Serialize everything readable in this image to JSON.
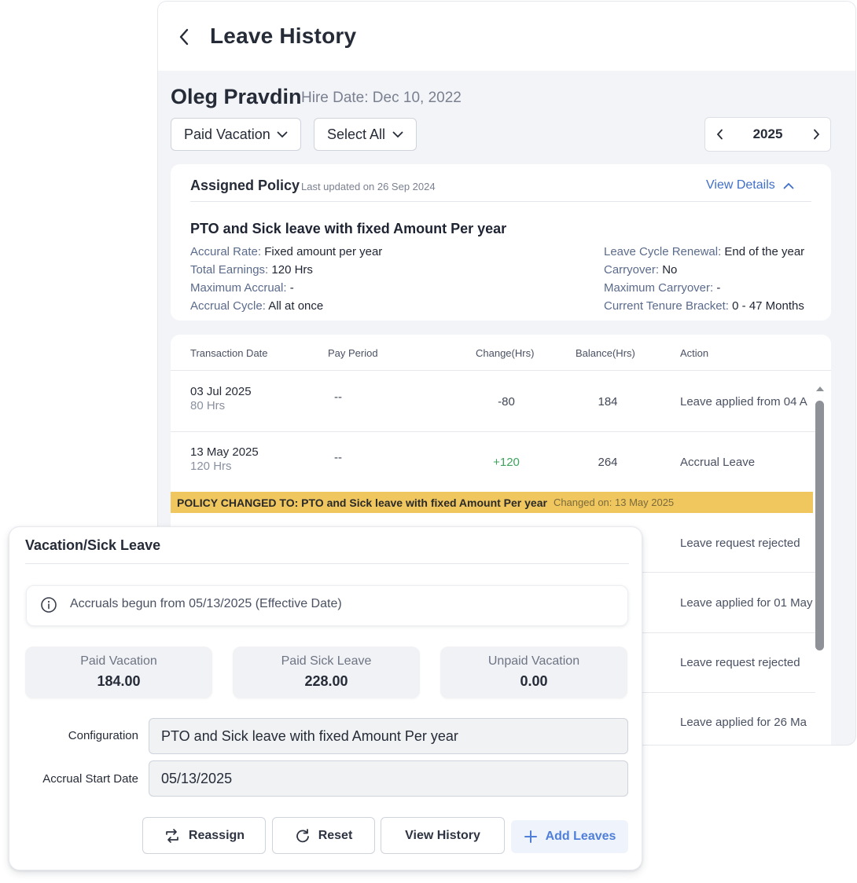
{
  "header": {
    "title": "Leave History"
  },
  "employee": {
    "name": "Oleg Pravdin",
    "hire_date": "Hire Date: Dec 10, 2022"
  },
  "filters": {
    "leave_type": "Paid Vacation",
    "status": "Select All"
  },
  "year_nav": {
    "year": "2025"
  },
  "policy": {
    "title": "Assigned Policy",
    "updated": "Last updated on 26 Sep 2024",
    "view_details": "View Details",
    "name": "PTO and Sick leave with fixed Amount Per year",
    "left": [
      {
        "key": "Accural Rate:",
        "value": "Fixed amount per year"
      },
      {
        "key": "Total Earnings:",
        "value": "120 Hrs"
      },
      {
        "key": "Maximum Accrual:",
        "value": "-"
      },
      {
        "key": "Accrual Cycle:",
        "value": "All at once"
      }
    ],
    "right": [
      {
        "key": "Leave Cycle Renewal:",
        "value": "End of the year"
      },
      {
        "key": "Carryover:",
        "value": "No"
      },
      {
        "key": "Maximum Carryover:",
        "value": "-"
      },
      {
        "key": "Current Tenure Bracket:",
        "value": "0 - 47 Months"
      }
    ]
  },
  "table": {
    "headers": [
      "Transaction Date",
      "Pay Period",
      "Change(Hrs)",
      "Balance(Hrs)",
      "Action"
    ],
    "rows": [
      {
        "date": "03 Jul 2025",
        "sub": "80 Hrs",
        "pay": "--",
        "change": "-80",
        "balance": "184",
        "action": "Leave applied from 04 A"
      },
      {
        "date": "13 May 2025",
        "sub": "120 Hrs",
        "pay": "--",
        "change": "+120",
        "balance": "264",
        "action": "Accrual Leave"
      },
      {
        "action": "Leave request rejected"
      },
      {
        "action": "Leave applied for 01 May"
      },
      {
        "action": "Leave request rejected"
      },
      {
        "action": "Leave applied for 26 Ma"
      }
    ],
    "banner": {
      "text": "POLICY CHANGED TO: PTO and Sick leave with fixed Amount Per year",
      "sub": "Changed on: 13 May 2025"
    }
  },
  "overlay": {
    "title": "Vacation/Sick Leave",
    "info": "Accruals begun from 05/13/2025 (Effective Date)",
    "stats": [
      {
        "label": "Paid Vacation",
        "value": "184.00"
      },
      {
        "label": "Paid Sick Leave",
        "value": "228.00"
      },
      {
        "label": "Unpaid Vacation",
        "value": "0.00"
      }
    ],
    "config_label": "Configuration",
    "config_value": "PTO and Sick leave with fixed Amount Per year",
    "accrual_label": "Accrual Start Date",
    "accrual_value": "05/13/2025",
    "buttons": {
      "reassign": "Reassign",
      "reset": "Reset",
      "history": "View History",
      "add": "Add Leaves"
    }
  },
  "colors": {
    "accent": "#3f6fc9",
    "banner": "#f0c75e",
    "positive": "#3ea35e"
  }
}
